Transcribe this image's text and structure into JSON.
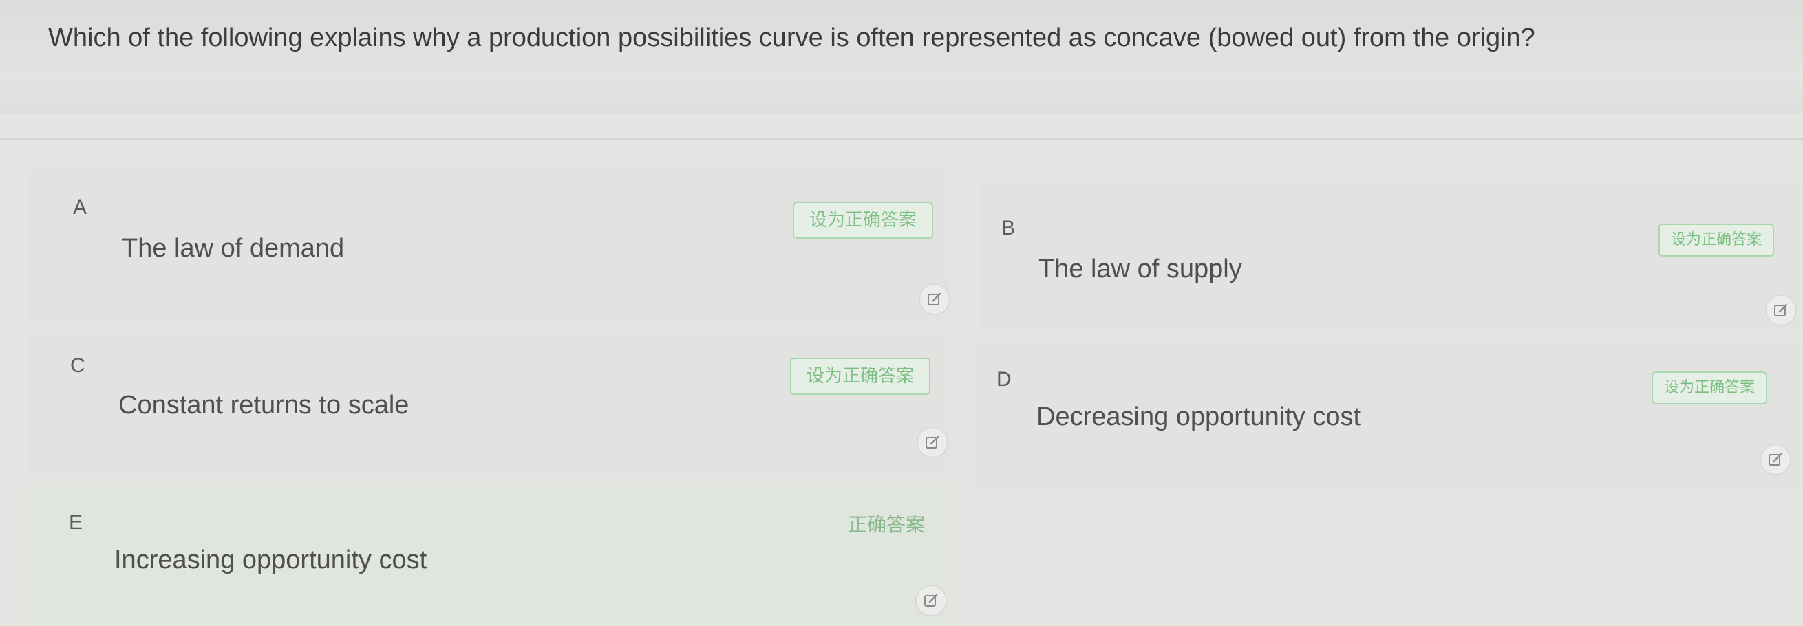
{
  "question": {
    "text": "Which of the following explains why a production possibilities curve is often represented as concave (bowed out) from the origin?"
  },
  "options": [
    {
      "letter": "A",
      "text": "The law of demand",
      "button_label": "设为正确答案",
      "is_correct": false
    },
    {
      "letter": "B",
      "text": "The law of supply",
      "button_label": "设为正确答案",
      "is_correct": false
    },
    {
      "letter": "C",
      "text": "Constant returns to scale",
      "button_label": "设为正确答案",
      "is_correct": false
    },
    {
      "letter": "D",
      "text": "Decreasing opportunity cost",
      "button_label": "设为正确答案",
      "is_correct": false
    },
    {
      "letter": "E",
      "text": "Increasing opportunity cost",
      "button_label": "正确答案",
      "is_correct": true
    }
  ],
  "icons": {
    "edit": "edit-icon"
  },
  "colors": {
    "correct_green": "#7bbf82",
    "correct_bg": "#e0e6dd"
  }
}
